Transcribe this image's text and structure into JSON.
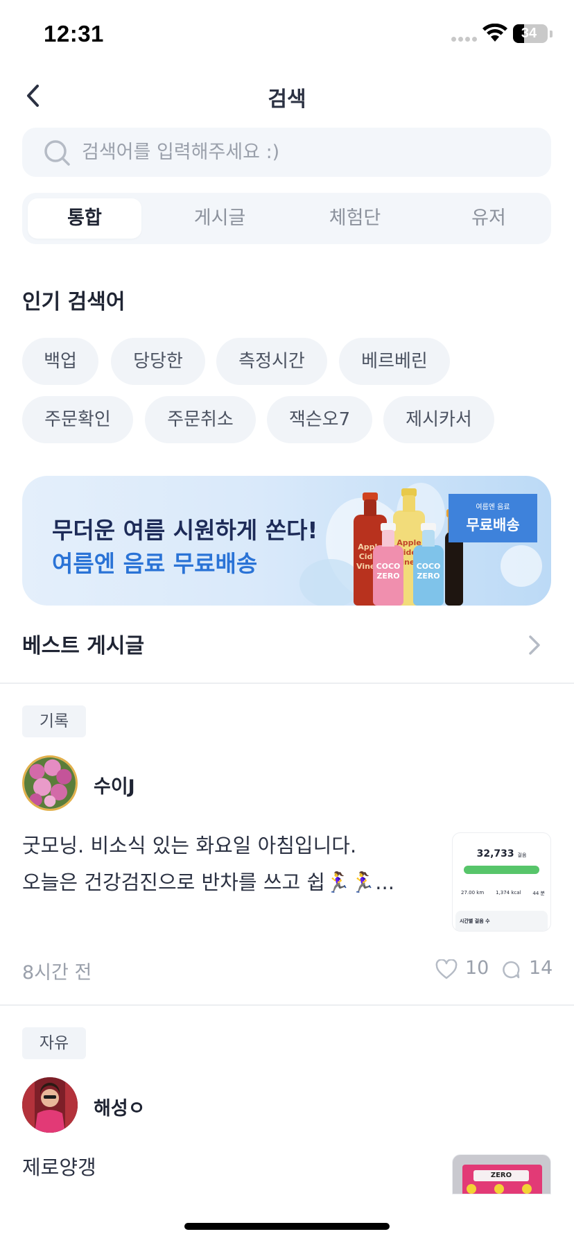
{
  "status": {
    "time": "12:31",
    "battery": "34"
  },
  "header": {
    "title": "검색"
  },
  "search": {
    "placeholder": "검색어를 입력해주세요 :)"
  },
  "tabs": [
    {
      "label": "통합",
      "active": true
    },
    {
      "label": "게시글",
      "active": false
    },
    {
      "label": "체험단",
      "active": false
    },
    {
      "label": "유저",
      "active": false
    }
  ],
  "popular": {
    "title": "인기 검색어",
    "keywords": [
      "백업",
      "당당한",
      "측정시간",
      "베르베린",
      "주문확인",
      "주문취소",
      "잭슨오7",
      "제시카서"
    ]
  },
  "banner": {
    "line1": "무더운 여름 시원하게 쏜다!",
    "line2": "여름엔 음료 무료배송",
    "badge_small": "여름엔 음료",
    "badge_big": "무료배송",
    "bottle_labels": [
      "Apple Cider Vinegar",
      "COCO ZERO",
      "Apple Cider Vinegar",
      "COCO ZERO"
    ]
  },
  "best": {
    "title": "베스트 게시글"
  },
  "posts": [
    {
      "category": "기록",
      "author": "수이J",
      "line1": "굿모닝. 비소식 있는 화요일 아침입니다.",
      "line2": "오늘은 건강검진으로 반차를  쓰고 쉽🏃‍♀️🏃‍♀️...",
      "time": "8시간 전",
      "likes": "10",
      "comments": "14",
      "thumb": {
        "steps": "32,733",
        "unit": "걸음",
        "km": "27.00 km",
        "kcal": "1,374 kcal",
        "extra": "44 분",
        "caption": "시간별 걸음 수",
        "progress": 1.0
      }
    },
    {
      "category": "자유",
      "author": "해성ㅇ",
      "line1": "제로양갱",
      "thumb": {
        "text": "ZERO"
      }
    }
  ],
  "colors": {
    "accent": "#2a73d6",
    "chip_bg": "#f1f4f8",
    "progress": "#57c56a"
  }
}
